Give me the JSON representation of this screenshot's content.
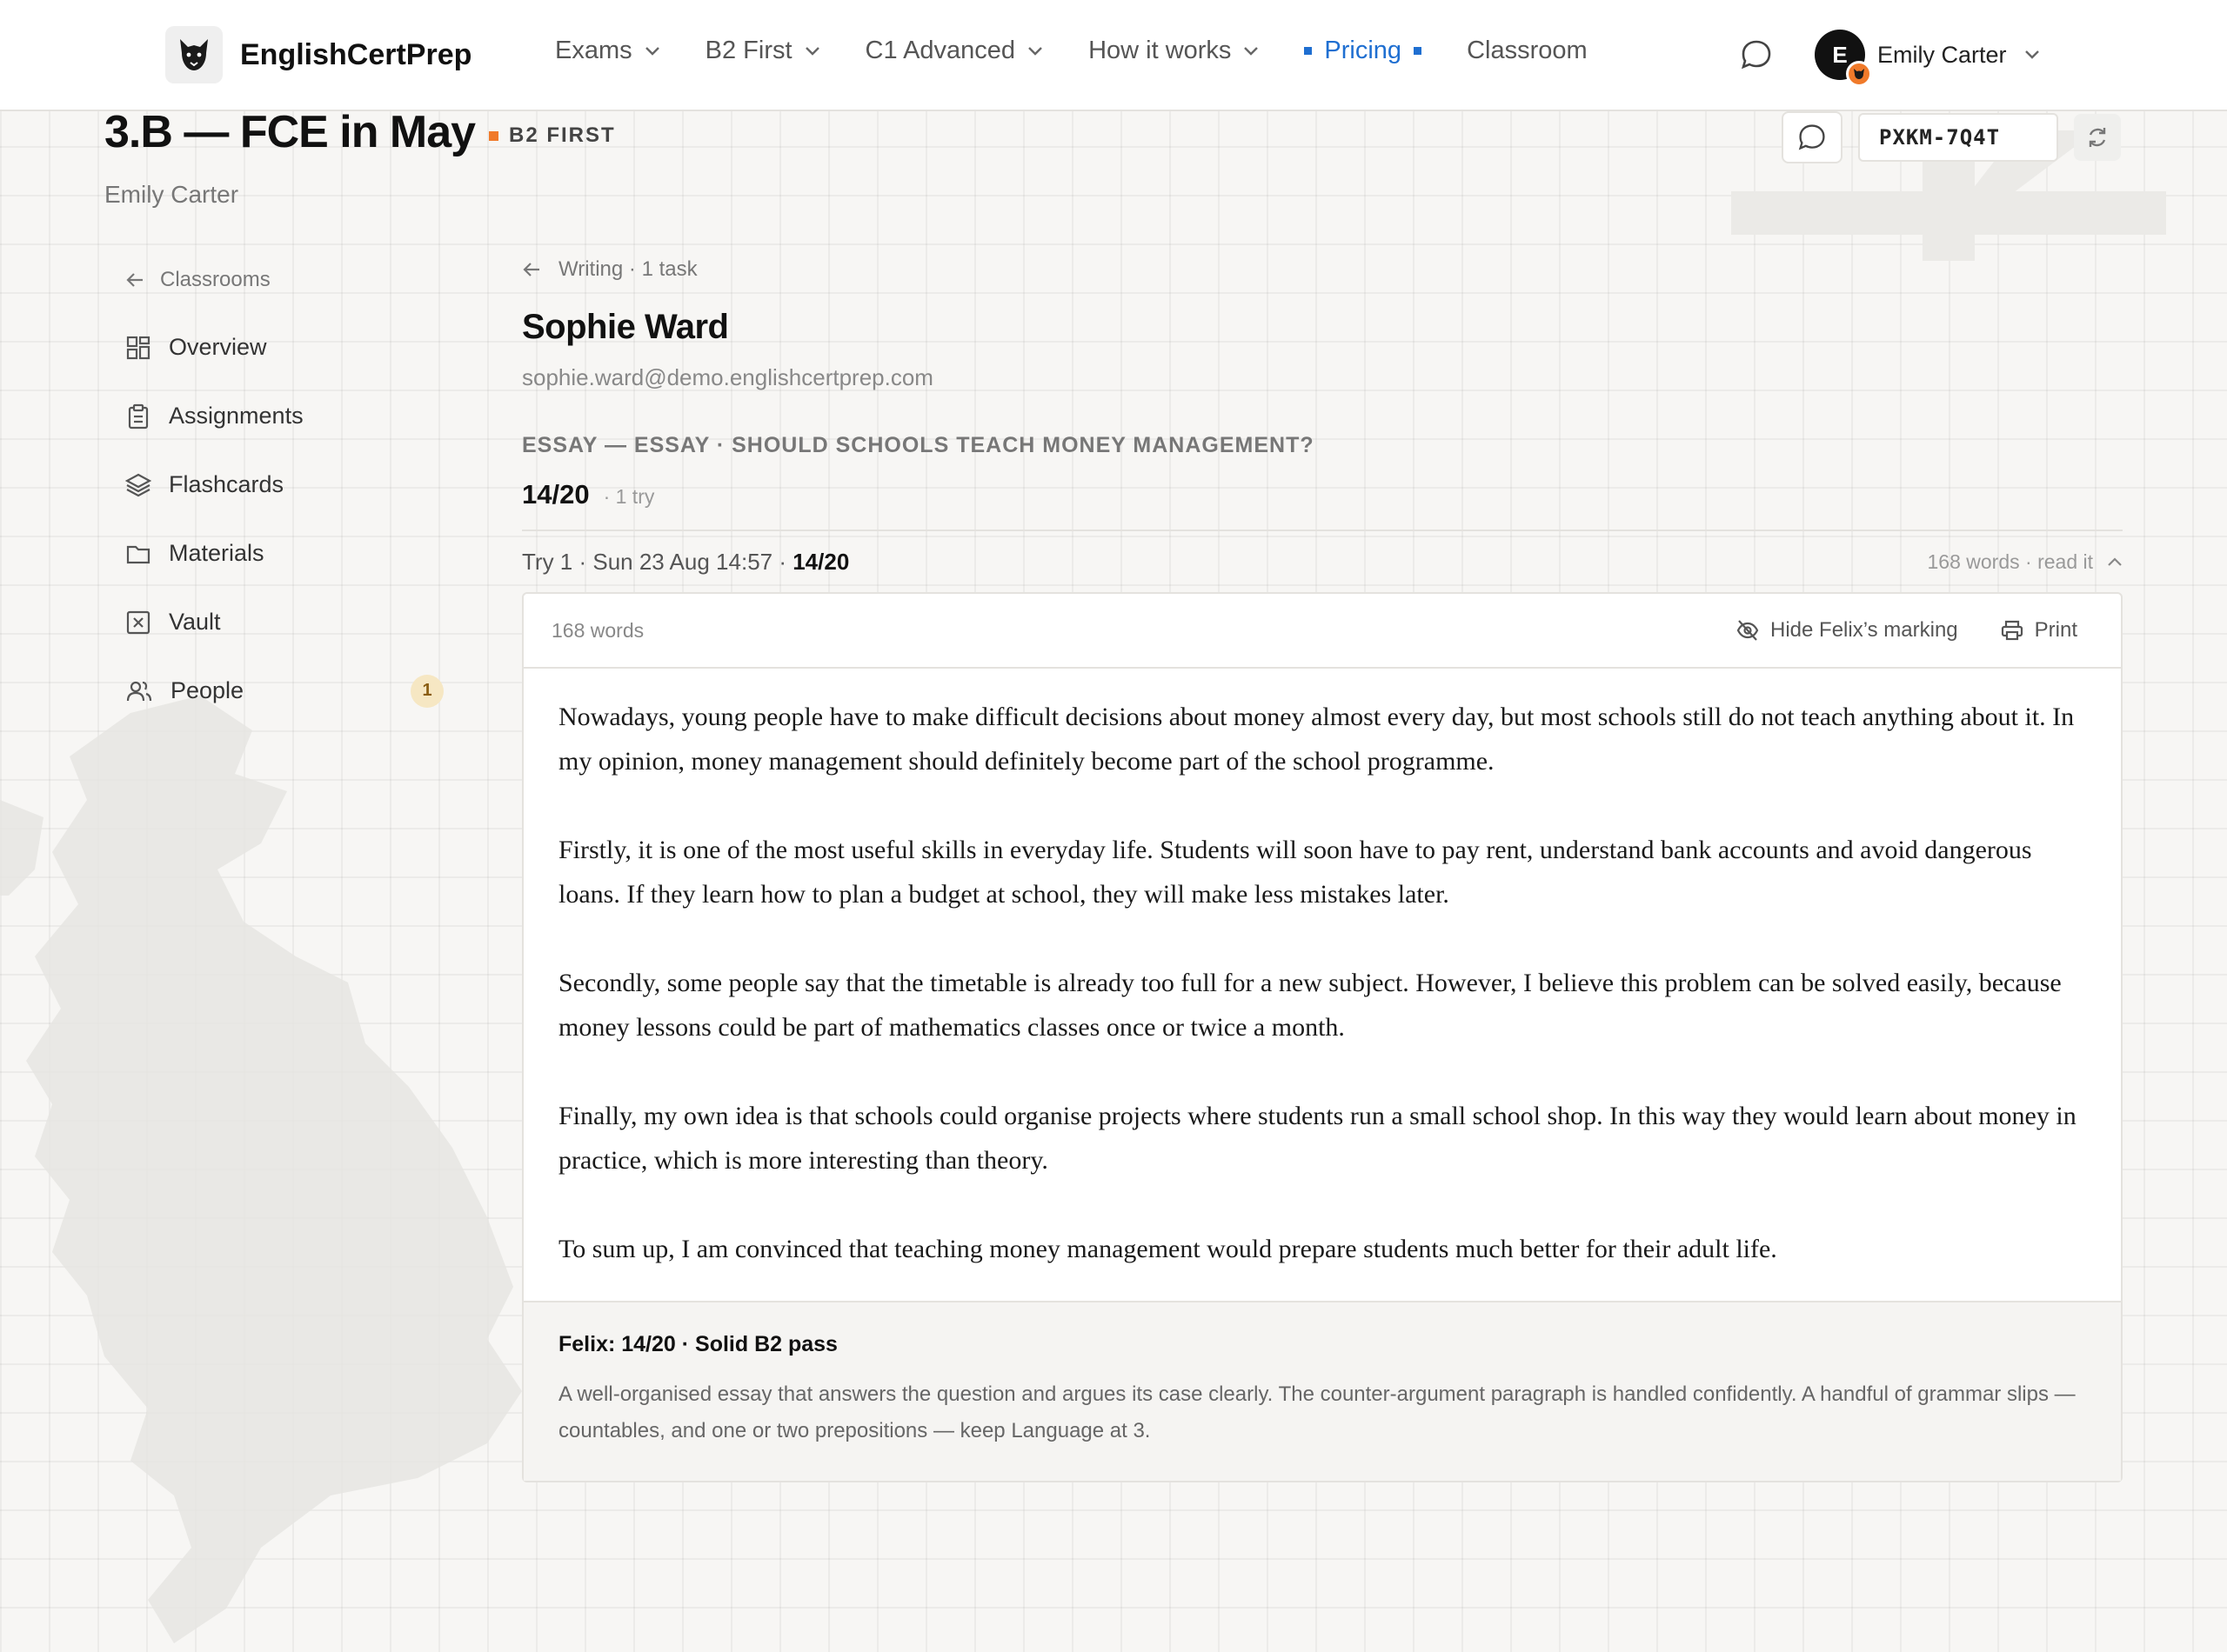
{
  "nav": {
    "brand": "EnglishCertPrep",
    "items": [
      {
        "label": "Exams",
        "dropdown": true,
        "active": false
      },
      {
        "label": "B2 First",
        "dropdown": true,
        "active": false
      },
      {
        "label": "C1 Advanced",
        "dropdown": true,
        "active": false
      },
      {
        "label": "How it works",
        "dropdown": true,
        "active": false
      },
      {
        "label": "Pricing",
        "dropdown": false,
        "active": true
      },
      {
        "label": "Classroom",
        "dropdown": false,
        "active": false
      }
    ],
    "user": {
      "initial": "E",
      "name": "Emily Carter"
    }
  },
  "classroom": {
    "title": "3.B — FCE in May",
    "level": "B2 FIRST",
    "teacher": "Emily Carter",
    "join_code": "PXKM-7Q4T"
  },
  "sidebar": {
    "back_label": "Classrooms",
    "items": [
      {
        "label": "Overview",
        "icon": "grid-icon"
      },
      {
        "label": "Assignments",
        "icon": "clipboard-icon"
      },
      {
        "label": "Flashcards",
        "icon": "layers-icon"
      },
      {
        "label": "Materials",
        "icon": "folder-icon"
      },
      {
        "label": "Vault",
        "icon": "vault-icon"
      },
      {
        "label": "People",
        "icon": "people-icon",
        "count": "1"
      }
    ]
  },
  "main": {
    "breadcrumb": "Writing · 1 task",
    "student_name": "Sophie Ward",
    "student_email": "sophie.ward@demo.englishcertprep.com",
    "task_title": "ESSAY — ESSAY · SHOULD SCHOOLS TEACH MONEY MANAGEMENT?",
    "score": "14/20",
    "tries": "· 1 try",
    "try_row": {
      "label": "Try 1 · Sun 23 Aug 14:57 · ",
      "score": "14/20",
      "right": "168 words · read it"
    },
    "essay": {
      "word_count": "168 words",
      "hide_marking_label": "Hide Felix’s marking",
      "print_label": "Print",
      "paragraphs": [
        "Nowadays, young people have to make difficult decisions about money almost every day, but most schools still do not teach anything about it. In my opinion, money management should definitely become part of the school programme.",
        "Firstly, it is one of the most useful skills in everyday life. Students will soon have to pay rent, understand bank accounts and avoid dangerous loans. If they learn how to plan a budget at school, they will make less mistakes later.",
        "Secondly, some people say that the timetable is already too full for a new subject. However, I believe this problem can be solved easily, because money lessons could be part of mathematics classes once or twice a month.",
        "Finally, my own idea is that schools could organise projects where students run a small school shop. In this way they would learn about money in practice, which is more interesting than theory.",
        "To sum up, I am convinced that teaching money management would prepare students much better for their adult life."
      ]
    },
    "feedback": {
      "title": "Felix: 14/20 · Solid B2 pass",
      "text": "A well-organised essay that answers the question and argues its case clearly. The counter-argument paragraph is handled confidently. A handful of grammar slips — countables, and one or two prepositions — keep Language at 3."
    }
  },
  "colors": {
    "accent": "#1f6fd1",
    "level_dot": "#f07a2a",
    "count_badge_bg": "#f6e7c3"
  }
}
